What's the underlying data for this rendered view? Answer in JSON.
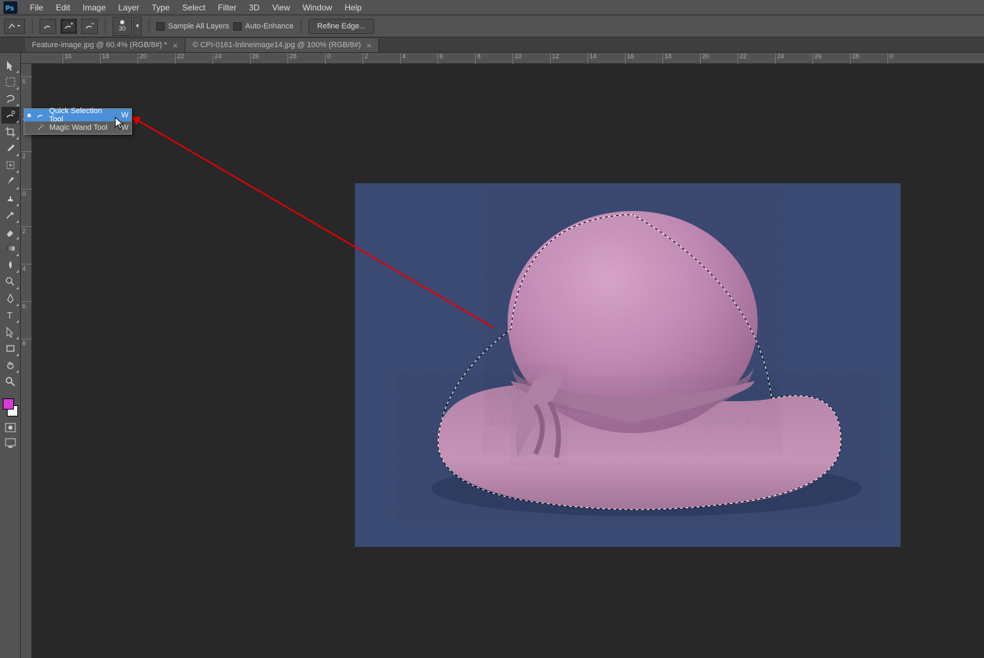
{
  "menu": {
    "items": [
      "File",
      "Edit",
      "Image",
      "Layer",
      "Type",
      "Select",
      "Filter",
      "3D",
      "View",
      "Window",
      "Help"
    ]
  },
  "options": {
    "brush_size": "30",
    "sample_all": "Sample All Layers",
    "auto_enhance": "Auto-Enhance",
    "refine": "Refine Edge..."
  },
  "tabs": [
    {
      "label": "Feature-image.jpg @ 60.4% (RGB/8#) *",
      "active": false
    },
    {
      "label": "© CPI-0161-Inlineimage14.jpg @ 100% (RGB/8#)",
      "active": true
    }
  ],
  "ruler_h": [
    "16",
    "18",
    "20",
    "22",
    "24",
    "26",
    "28",
    "0",
    "2",
    "4",
    "6",
    "8",
    "10",
    "12",
    "14",
    "16",
    "18",
    "20",
    "22",
    "24",
    "26",
    "28",
    "0"
  ],
  "ruler_v": [
    "6",
    "4",
    "2",
    "0",
    "2",
    "4",
    "6",
    "8"
  ],
  "flyout": {
    "items": [
      {
        "dot": "■",
        "label": "Quick Selection Tool",
        "key": "W",
        "hl": true
      },
      {
        "dot": "",
        "label": "Magic Wand Tool",
        "key": "W",
        "hl": false
      }
    ]
  },
  "colors": {
    "fg": "#d63cd6",
    "bg": "#ffffff",
    "canvas_bg": "#3b4a73"
  }
}
